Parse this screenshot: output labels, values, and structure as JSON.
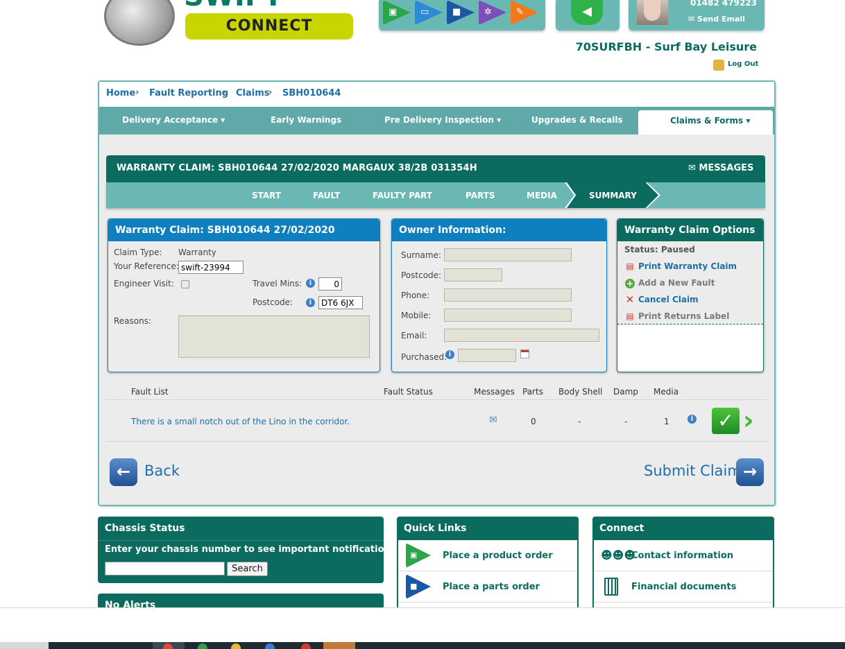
{
  "header": {
    "logo_word": "SWIFT",
    "connect_label": "CONNECT",
    "phone": "01482 479223",
    "send_email": "Send Email",
    "dealer": "70SURFBH - Surf Bay Leisure",
    "logout": "Log Out",
    "quick_icons": [
      "caravan-icon",
      "computer-icon",
      "truck-icon",
      "gears-icon",
      "tools-icon"
    ],
    "megaphone_icon": "megaphone-icon"
  },
  "breadcrumb": [
    "Home",
    "Fault Reporting",
    "Claims",
    "SBH010644"
  ],
  "nav": {
    "items": [
      "Delivery Acceptance",
      "Early Warnings",
      "Pre Delivery Inspection",
      "Upgrades & Recalls",
      "Claims & Forms"
    ],
    "active": "Claims & Forms"
  },
  "claim": {
    "title": "WARRANTY CLAIM: SBH010644 27/02/2020 MARGAUX 38/2B 031354H",
    "messages": "MESSAGES",
    "steps": [
      "START",
      "FAULT",
      "FAULTY PART",
      "PARTS",
      "MEDIA",
      "SUMMARY"
    ],
    "active_step": "SUMMARY"
  },
  "warranty_panel": {
    "title": "Warranty Claim: SBH010644 27/02/2020",
    "claim_type_label": "Claim Type:",
    "claim_type_value": "Warranty",
    "reference_label": "Your Reference:",
    "reference_value": "swift-23994",
    "engineer_label": "Engineer Visit:",
    "engineer_checked": false,
    "travel_label": "Travel Mins:",
    "travel_value": "0",
    "postcode_label": "Postcode:",
    "postcode_value": "DT6 6JX",
    "reasons_label": "Reasons:"
  },
  "owner_panel": {
    "title": "Owner Information:",
    "fields": [
      "Surname:",
      "Postcode:",
      "Phone:",
      "Mobile:",
      "Email:",
      "Purchased:"
    ]
  },
  "options_panel": {
    "title": "Warranty Claim Options",
    "status": "Status: Paused",
    "options": [
      {
        "label": "Print Warranty Claim",
        "icon": "pdf-icon",
        "color": "#1d6fa6"
      },
      {
        "label": "Add a New Fault",
        "icon": "add-icon",
        "color": "#7a7a7a"
      },
      {
        "label": "Cancel Claim",
        "icon": "cancel-icon",
        "color": "#1d6fa6"
      },
      {
        "label": "Print Returns Label",
        "icon": "pdf-icon",
        "color": "#7a7a7a"
      }
    ]
  },
  "fault_list": {
    "headers": [
      "Fault List",
      "Fault Status",
      "Messages",
      "Parts",
      "Body Shell",
      "Damp",
      "Media"
    ],
    "rows": [
      {
        "description": "There is a small notch out of the Lino in the corridor.",
        "status": "",
        "parts": "0",
        "body_shell": "-",
        "damp": "-",
        "media": "1"
      }
    ]
  },
  "actions": {
    "back": "Back",
    "submit": "Submit Claim"
  },
  "chassis_status": {
    "title": "Chassis Status",
    "prompt": "Enter your chassis number to see important notifications:",
    "input_value": "",
    "search": "Search"
  },
  "alerts": {
    "title": "No Alerts"
  },
  "quick_links": {
    "title": "Quick Links",
    "items": [
      "Place a product order",
      "Place a parts order"
    ]
  },
  "connect": {
    "title": "Connect",
    "items": [
      "Contact information",
      "Financial documents"
    ]
  },
  "colors": {
    "brand_dark": "#0a6b5e",
    "brand_light": "#6ab8b4",
    "panel_blue": "#0f7fbf",
    "link_blue": "#1d6fa6",
    "accent_lime": "#c9d500"
  }
}
